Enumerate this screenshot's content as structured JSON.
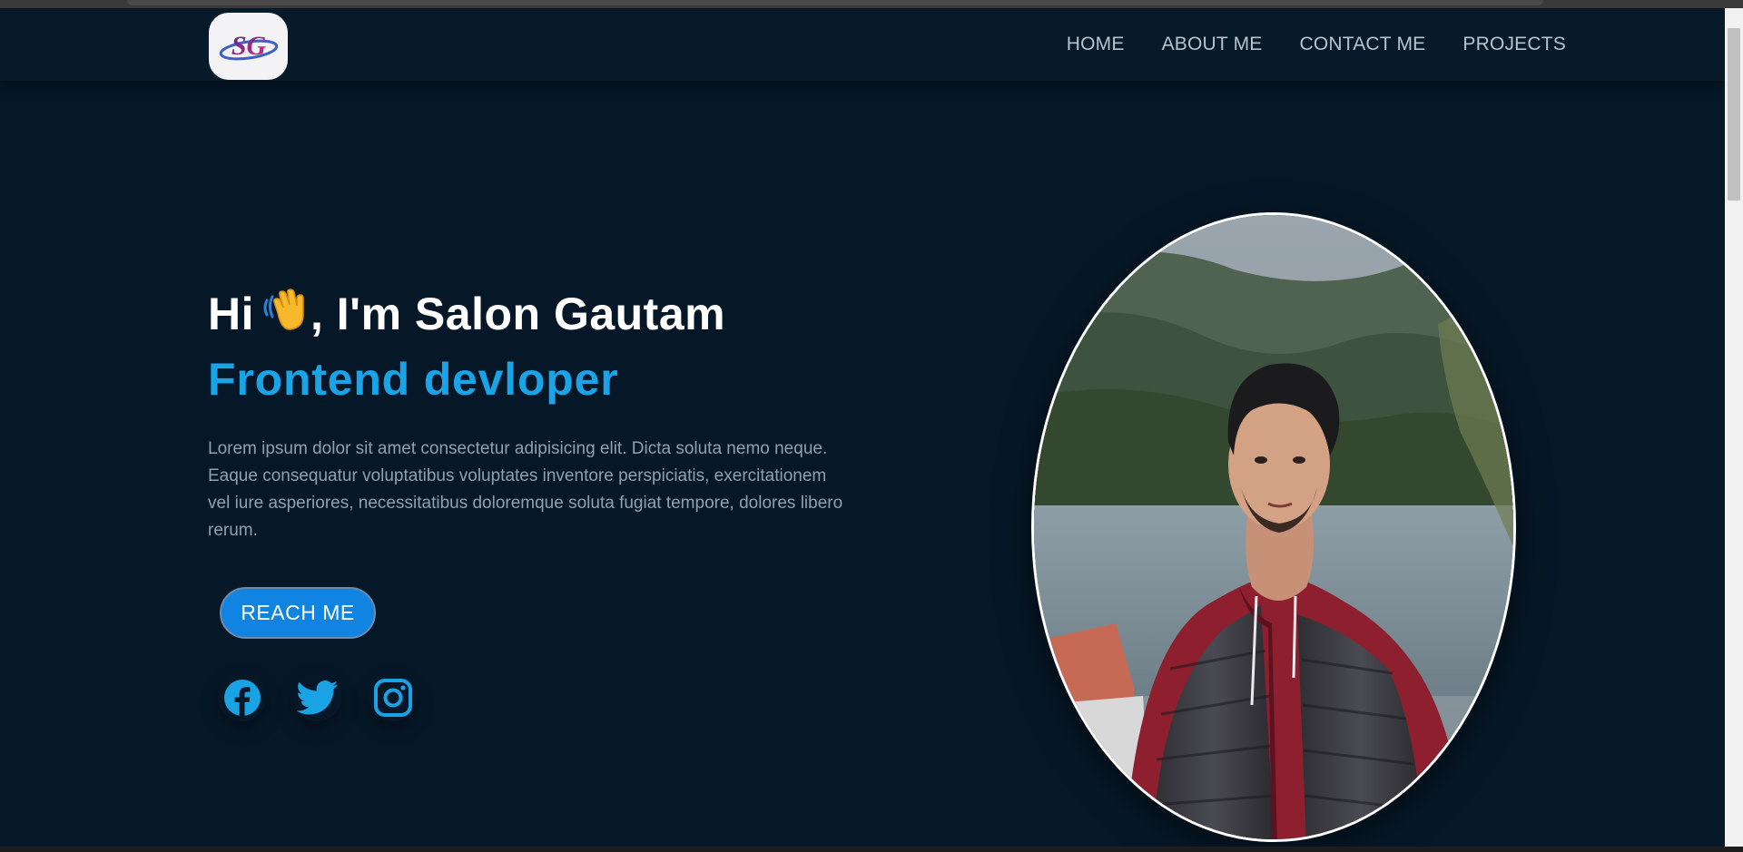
{
  "logo": {
    "text": "SG"
  },
  "nav": {
    "items": [
      "HOME",
      "ABOUT ME",
      "CONTACT ME",
      "PROJECTS"
    ]
  },
  "hero": {
    "greeting_before": "Hi",
    "greeting_after": ", I'm Salon Gautam",
    "emoji": "👋",
    "subtitle": "Frontend devloper",
    "description": "Lorem ipsum dolor sit amet consectetur adipisicing elit. Dicta soluta nemo neque. Eaque consequatur voluptatibus voluptates inventore perspiciatis, exercitationem vel iure asperiores, necessitatibus doloremque soluta fugiat tempore, dolores libero rerum.",
    "button": "REACH ME"
  },
  "socials": [
    {
      "icon": "facebook-icon"
    },
    {
      "icon": "twitter-icon"
    },
    {
      "icon": "instagram-icon"
    }
  ],
  "colors": {
    "background": "#061827",
    "header": "#071a2a",
    "accent": "#1aa4e8",
    "button": "#1183e0",
    "social_icon": "#19a3e5"
  }
}
